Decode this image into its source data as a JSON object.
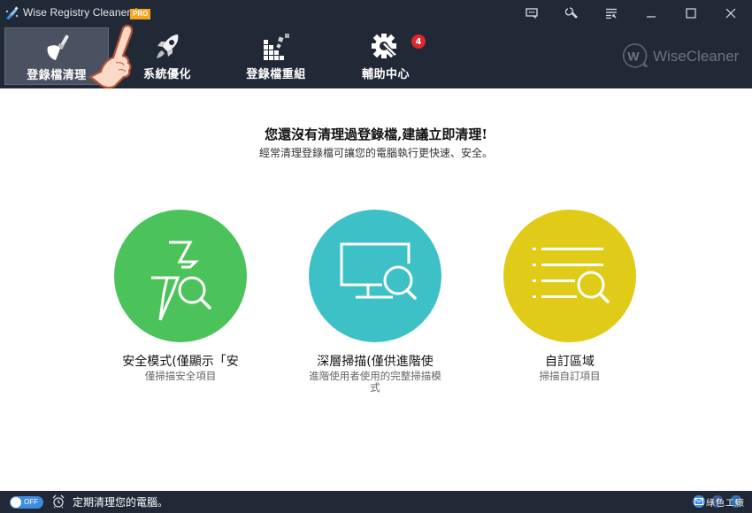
{
  "app": {
    "title": "Wise Registry Cleaner 9",
    "badge": "PRO"
  },
  "window_controls": [
    {
      "name": "feedback-icon"
    },
    {
      "name": "settings-wrench-icon"
    },
    {
      "name": "menu-icon"
    },
    {
      "name": "minimize-icon"
    },
    {
      "name": "maximize-icon"
    },
    {
      "name": "close-icon"
    }
  ],
  "nav": {
    "tabs": [
      {
        "label": "登錄檔清理",
        "icon": "broom-icon",
        "active": true
      },
      {
        "label": "系統優化",
        "icon": "rocket-icon",
        "active": false
      },
      {
        "label": "登錄檔重組",
        "icon": "defrag-blocks-icon",
        "active": false
      },
      {
        "label": "輔助中心",
        "icon": "gear-wrench-icon",
        "active": false,
        "badge": "4"
      }
    ]
  },
  "brand": {
    "logo_letter": "W",
    "name": "WiseCleaner"
  },
  "main": {
    "headline": "您還沒有清理過登錄檔,建議立即清理!",
    "subline": "經常清理登錄檔可讓您的電腦執行更快速、安全。",
    "options": [
      {
        "title": "安全模式(僅顯示「安",
        "desc": "僅掃描安全項目",
        "color": "#4cc35a",
        "icon": "lightning-search-icon"
      },
      {
        "title": "深層掃描(僅供進階使",
        "desc": "進階使用者使用的完整掃描模式",
        "color": "#3ec1c6",
        "icon": "monitor-search-icon"
      },
      {
        "title": "自訂區域",
        "desc": "掃描自訂項目",
        "color": "#e0cb19",
        "icon": "list-search-icon"
      }
    ]
  },
  "statusbar": {
    "toggle_state": "OFF",
    "schedule_text": "定期清理您的電腦。",
    "social": [
      {
        "name": "mail-icon",
        "color": "#3a8de0"
      },
      {
        "name": "facebook-icon",
        "color": "#3b5b9a"
      },
      {
        "name": "twitter-icon",
        "color": "#2f78b8"
      }
    ],
    "watermark": "綠色工廠"
  }
}
